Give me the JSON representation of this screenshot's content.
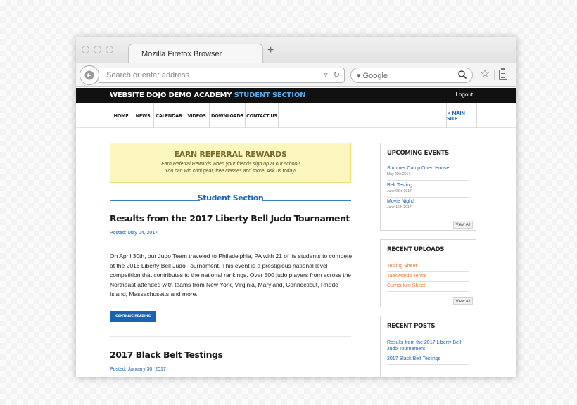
{
  "browser": {
    "tab_title": "Mozilla Firefox Browser",
    "new_tab_symbol": "+",
    "url_placeholder": "Search or enter address",
    "search_engine_label": "Google"
  },
  "site": {
    "brand_main": "WEBSITE DOJO DEMO ACADEMY",
    "brand_accent": "STUDENT SECTION",
    "logout_label": "Logout",
    "nav": [
      "HOME",
      "NEWS",
      "CALENDAR",
      "VIDEOS",
      "DOWNLOADS",
      "CONTACT US"
    ],
    "main_site_label": "< MAIN SITE",
    "accent_color": "#1a6ab8"
  },
  "referral": {
    "title": "EARN REFERRAL REWARDS",
    "line1": "Earn Referral Rewards when your friends sign up at our school!",
    "line2": "You can win cool gear, free classes and more! Ask us today!"
  },
  "section_title": "Student Section",
  "posts": [
    {
      "title": "Results from the 2017 Liberty Bell Judo Tournament",
      "date": "Posted: May 04, 2017",
      "body": "On April 30th, our Judo Team traveled to Philadelphia, PA with 21 of its students to compete at the 2016 Liberty Bell Judo Tournament. This event is a prestigious national level competition that contributes to the national rankings. Over 500 judo players from across the Northeast attended with teams from New York, Virginia, Maryland, Connecticut, Rhode Island, Massachusetts and more.",
      "cta": "CONTINUE READING"
    },
    {
      "title": "2017 Black Belt Testings",
      "date": "Posted: January 30, 2017"
    }
  ],
  "sidebar": {
    "events": {
      "title": "UPCOMING EVENTS",
      "items": [
        {
          "name": "Summer Camp Open House",
          "date": "May 20th 2017"
        },
        {
          "name": "Belt Testing",
          "date": "June 03rd 2017"
        },
        {
          "name": "Movie Night!",
          "date": "June 16th 2017"
        }
      ],
      "view_all": "View All"
    },
    "uploads": {
      "title": "RECENT UPLOADS",
      "items": [
        "Testing Sheet",
        "Taekwondo Terms",
        "Curriculum Sheet"
      ],
      "view_all": "View All"
    },
    "recent_posts": {
      "title": "RECENT POSTS",
      "items": [
        "Results from the 2017 Liberty Bell Judo Tournament",
        "2017 Black Belt Testings"
      ]
    }
  }
}
